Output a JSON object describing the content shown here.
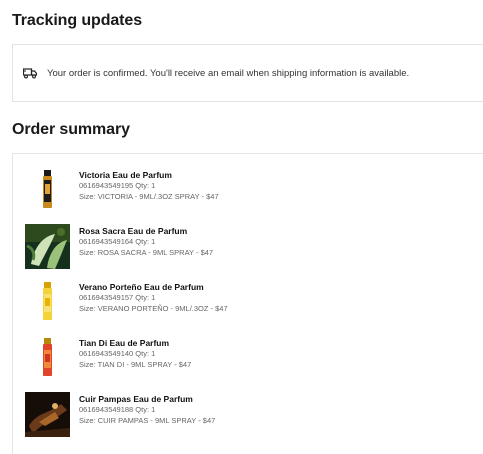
{
  "tracking": {
    "title": "Tracking updates",
    "message": "Your order is confirmed. You'll receive an email when shipping information is available.",
    "icon": "truck-icon"
  },
  "summary": {
    "title": "Order summary",
    "items": [
      {
        "name": "Victoria Eau de Parfum",
        "sku_qty": "0616943549195 Qty: 1",
        "size": "Size: VICTORIA - 9ML/.3OZ SPRAY - $47",
        "image": "vial-amber-photo"
      },
      {
        "name": "Rosa Sacra Eau de Parfum",
        "sku_qty": "0616943549164 Qty: 1",
        "size": "Size: ROSA SACRA - 9ML SPRAY - $47",
        "image": "calla-lily-photo"
      },
      {
        "name": "Verano Porteño Eau de Parfum",
        "sku_qty": "0616943549157 Qty: 1",
        "size": "Size: VERANO PORTEÑO - 9ML/.3OZ - $47",
        "image": "vial-yellow-photo"
      },
      {
        "name": "Tian Di Eau de Parfum",
        "sku_qty": "0616943549140 Qty: 1",
        "size": "Size: TIAN DI - 9ML SPRAY - $47",
        "image": "vial-red-photo"
      },
      {
        "name": "Cuir Pampas Eau de Parfum",
        "sku_qty": "0616943549188 Qty: 1",
        "size": "Size: CUIR PAMPAS - 9ML SPRAY - $47",
        "image": "leather-still-life-photo"
      }
    ]
  }
}
